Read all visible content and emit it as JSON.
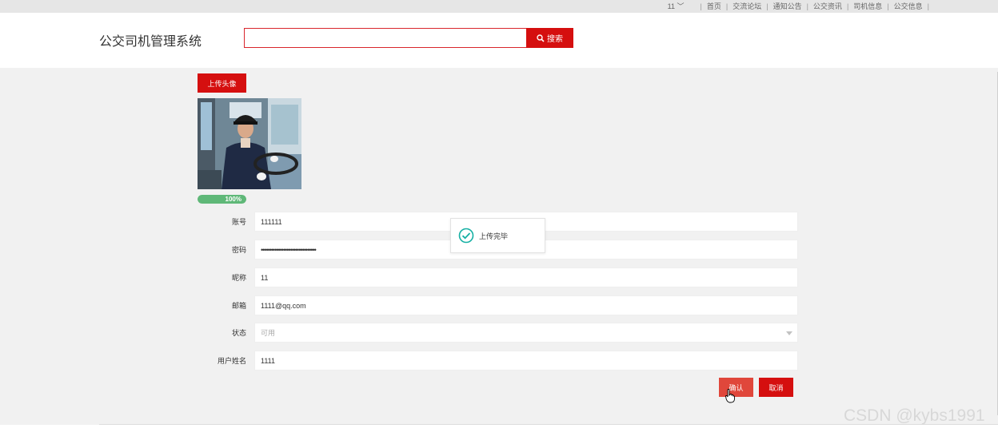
{
  "top_nav": {
    "user": "11",
    "items": [
      "首页",
      "交流论坛",
      "通知公告",
      "公交资讯",
      "司机信息",
      "公交信息"
    ]
  },
  "header": {
    "title": "公交司机管理系统",
    "search_value": "",
    "search_button": "搜索"
  },
  "profile": {
    "upload_button": "上传头像",
    "upload_progress": 100,
    "upload_progress_label": "100%"
  },
  "form": {
    "account_label": "账号",
    "account_value": "111111",
    "password_label": "密码",
    "password_value": "••••••••••••••••••••••••••••••••",
    "nickname_label": "昵称",
    "nickname_value": "11",
    "email_label": "邮箱",
    "email_value": "1111@qq.com",
    "status_label": "状态",
    "status_value": "可用",
    "realname_label": "用户姓名",
    "realname_value": "1111",
    "confirm_button": "确认",
    "cancel_button": "取消"
  },
  "toast": {
    "message": "上传完毕"
  },
  "watermark": "CSDN @kybs1991",
  "colors": {
    "primary": "#d50f0f",
    "confirm": "#e0473b",
    "progress": "#5fb878",
    "toast_icon": "#16b0a4"
  }
}
